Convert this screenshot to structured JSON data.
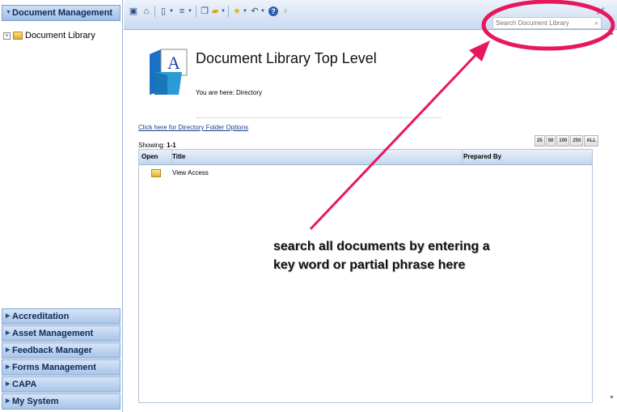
{
  "sidebar": {
    "header": "Document Management",
    "tree": [
      {
        "label": "Document Library"
      }
    ],
    "sections": [
      {
        "label": "Accreditation"
      },
      {
        "label": "Asset Management"
      },
      {
        "label": "Feedback Manager"
      },
      {
        "label": "Forms Management"
      },
      {
        "label": "CAPA"
      },
      {
        "label": "My System"
      }
    ]
  },
  "toolbar": {
    "icons": [
      "save-icon",
      "home-icon",
      "new-document-icon",
      "list-icon",
      "copy-icon",
      "folder-icon",
      "star-icon",
      "undo-icon",
      "help-icon",
      "lightbulb-icon"
    ],
    "close": "✕"
  },
  "search": {
    "placeholder": "Search Document Library"
  },
  "main": {
    "title": "Document Library Top Level",
    "breadcrumb": "You are here: Directory",
    "folder_options_link": "Click here for Directory Folder Options",
    "showing_label": "Showing:",
    "showing_range": "1-1",
    "page_sizes": [
      "25",
      "50",
      "100",
      "250",
      "ALL"
    ],
    "columns": {
      "open": "Open",
      "title": "Title",
      "prepared_by": "Prepared By"
    },
    "rows": [
      {
        "title": "View Access",
        "prepared_by": ""
      }
    ]
  },
  "logo": {
    "letter": "A"
  },
  "annotation": {
    "text": "search all documents by entering a key word or partial phrase here",
    "color": "#e8175d"
  }
}
